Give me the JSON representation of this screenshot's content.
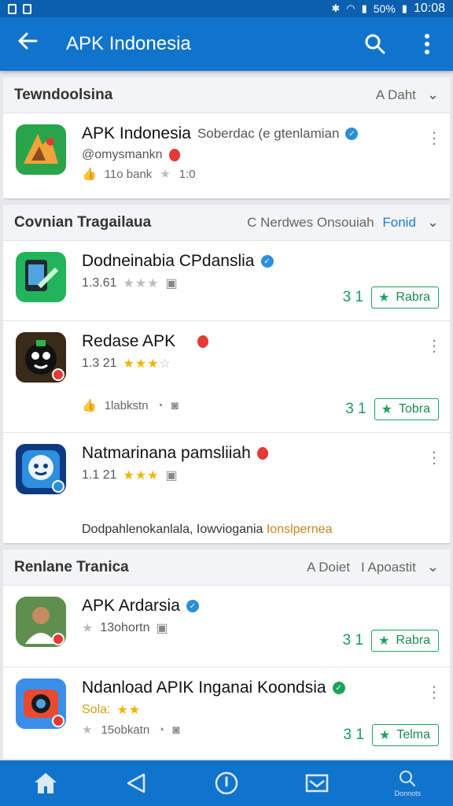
{
  "status_bar": {
    "battery": "50%",
    "time": "10:08"
  },
  "app_bar": {
    "title": "APK Indonesia"
  },
  "sections": [
    {
      "name": "Tewndoolsina",
      "filter": "A Daht",
      "items": [
        {
          "title": "APK Indonesia",
          "subtitle": "Soberdac (e gtenlamian",
          "handle": "@omysmankn",
          "stats": "11o bank",
          "stats2": "1:0"
        }
      ]
    },
    {
      "name": "Covnian Tragailaua",
      "filter": "C Nerdwes Onsouiah",
      "filter_accent": "Fonid",
      "items": [
        {
          "title": "Dodneinabia CPdanslia",
          "rating": "1.3.61",
          "install_count": "3 1",
          "button": "Rabra"
        },
        {
          "title": "Redase APK",
          "rating": "1.3 21",
          "meta": "1labkstn",
          "install_count": "3 1",
          "button": "Tobra"
        },
        {
          "title": "Natmarinana pamsliiah",
          "rating": "1.1 21",
          "note": "Dodpahlenokanlala, Iowviogania",
          "note_link": "Ionslpernea"
        }
      ]
    },
    {
      "name": "Renlane Tranica",
      "filter": "A Doiet",
      "filter_green": "I Apoastit",
      "items": [
        {
          "title": "APK Ardarsia",
          "meta": "13ohortn",
          "install_count": "3 1",
          "button": "Rabra"
        },
        {
          "title": "Ndanload APIK Inganai Koondsia",
          "tag": "Sola:",
          "meta": "15obkatn",
          "install_count": "3 1",
          "button": "Telma"
        }
      ]
    }
  ],
  "bottom_nav": {
    "search_label": "Donnots"
  }
}
